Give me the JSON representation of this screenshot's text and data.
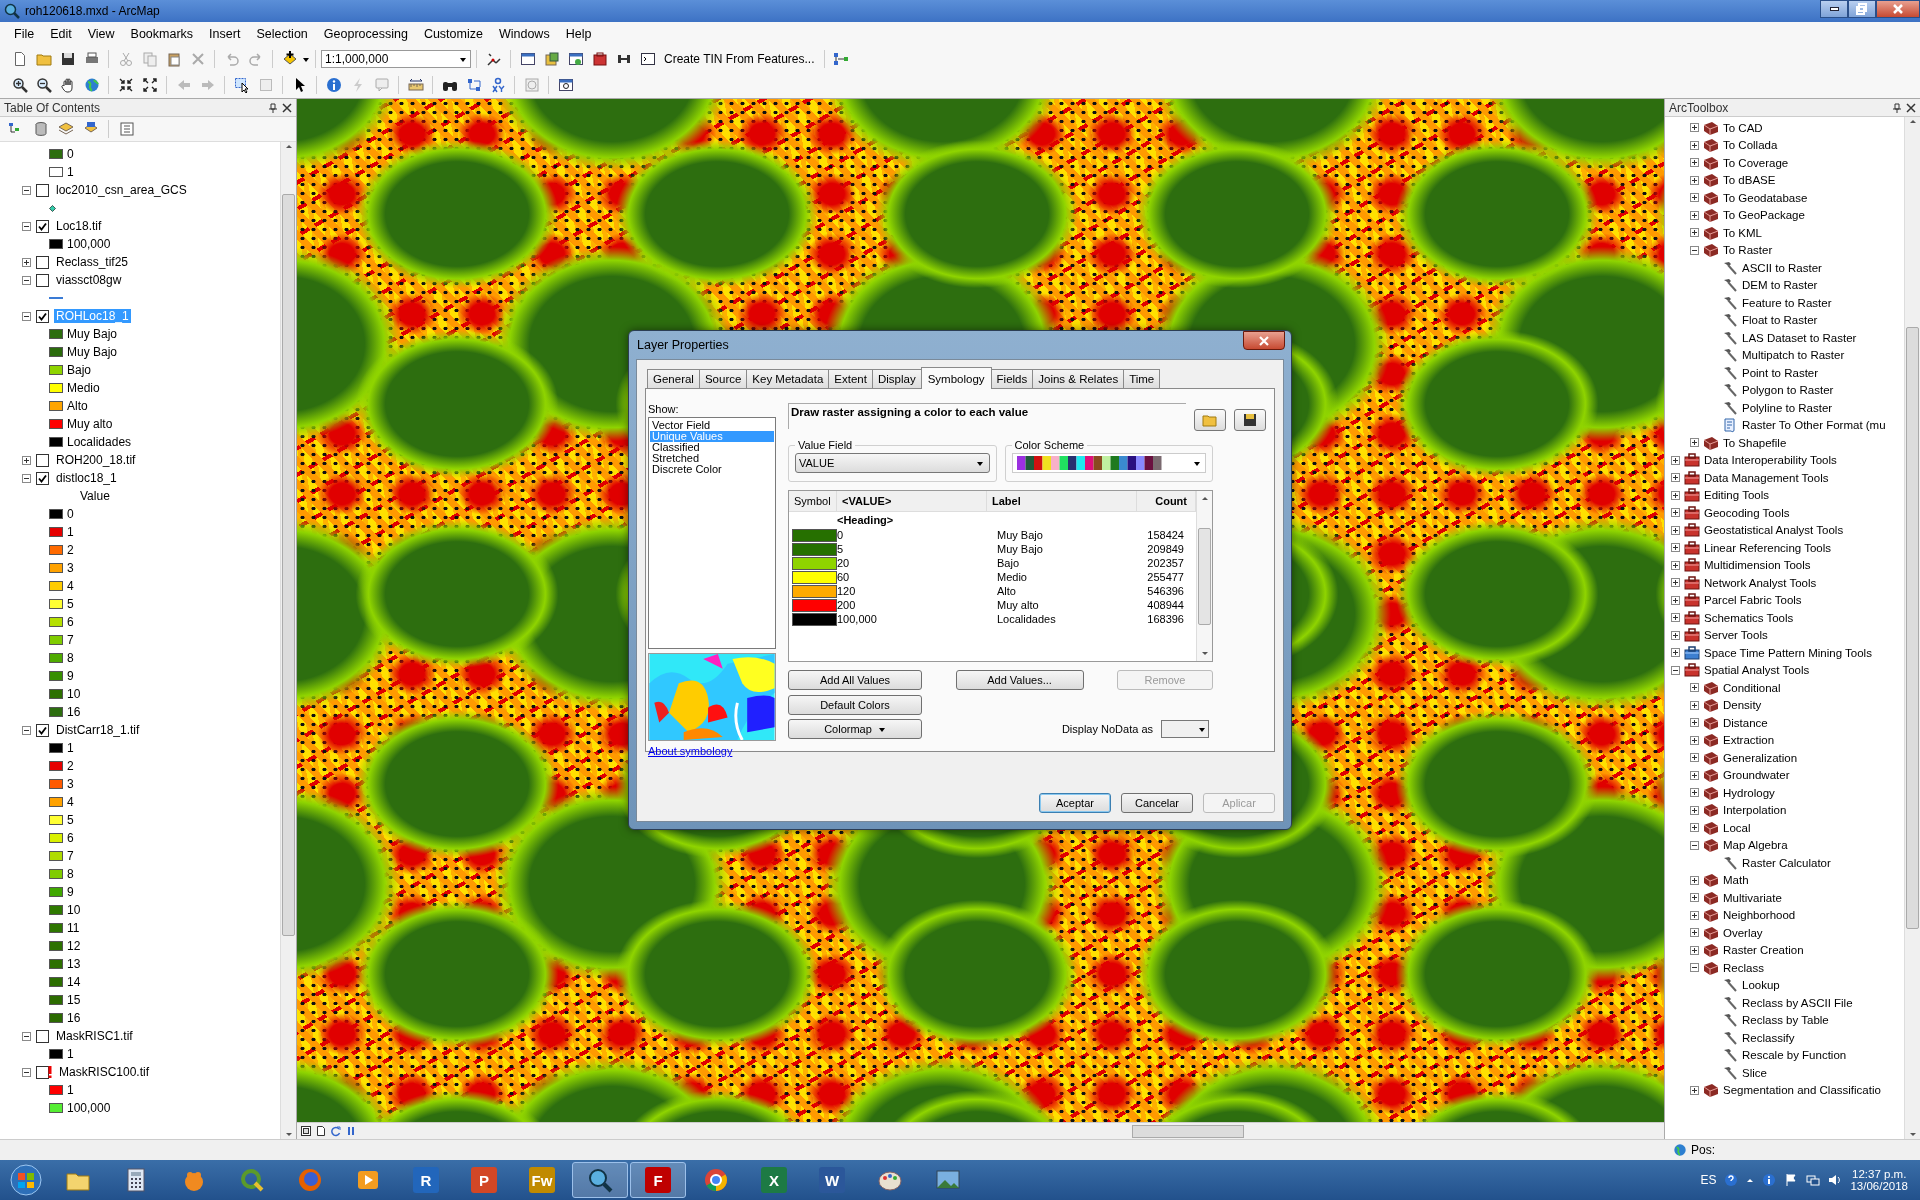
{
  "window": {
    "title": "roh120618.mxd - ArcMap"
  },
  "menu": [
    "File",
    "Edit",
    "View",
    "Bookmarks",
    "Insert",
    "Selection",
    "Geoprocessing",
    "Customize",
    "Windows",
    "Help"
  ],
  "toolbar": {
    "scale": "1:1,000,000",
    "tool_button": "Create TIN From Features..."
  },
  "toc": {
    "title": "Table Of Contents",
    "partial_legend": [
      {
        "kind": "swatch",
        "label": "0",
        "color": "#2d6e0f"
      },
      {
        "kind": "swatch",
        "label": "1",
        "color": "#ffffff"
      }
    ],
    "layers": [
      {
        "name": "loc2010_csn_area_GCS",
        "checked": false,
        "expanded": true,
        "selected": false,
        "warning": false,
        "legend": [
          {
            "kind": "point",
            "color": "#33ccaa"
          }
        ]
      },
      {
        "name": "Loc18.tif",
        "checked": true,
        "expanded": true,
        "selected": false,
        "warning": false,
        "legend": [
          {
            "kind": "swatch",
            "label": "100,000",
            "color": "#000000"
          }
        ]
      },
      {
        "name": "Reclass_tif25",
        "checked": false,
        "expanded": false,
        "selected": false,
        "warning": false
      },
      {
        "name": "viassct08gw",
        "checked": false,
        "expanded": true,
        "selected": false,
        "warning": false,
        "legend": [
          {
            "kind": "line",
            "color": "#3a7bd5"
          }
        ]
      },
      {
        "name": "ROHLoc18_1",
        "checked": true,
        "expanded": true,
        "selected": true,
        "warning": false,
        "legend": [
          {
            "kind": "swatch",
            "label": "Muy Bajo",
            "color": "#2d6e0f"
          },
          {
            "kind": "swatch",
            "label": "Muy Bajo",
            "color": "#2b6b0c"
          },
          {
            "kind": "swatch",
            "label": "Bajo",
            "color": "#8fd400"
          },
          {
            "kind": "swatch",
            "label": "Medio",
            "color": "#ffff00"
          },
          {
            "kind": "swatch",
            "label": "Alto",
            "color": "#ffa500"
          },
          {
            "kind": "swatch",
            "label": "Muy alto",
            "color": "#ff0000"
          },
          {
            "kind": "swatch",
            "label": "Localidades",
            "color": "#000000"
          }
        ]
      },
      {
        "name": "ROH200_18.tif",
        "checked": false,
        "expanded": false,
        "selected": false,
        "warning": false
      },
      {
        "name": "distloc18_1",
        "checked": true,
        "expanded": true,
        "selected": false,
        "warning": false,
        "legend": [
          {
            "kind": "heading",
            "label": "Value"
          },
          {
            "kind": "swatch",
            "label": "0",
            "color": "#000000"
          },
          {
            "kind": "swatch",
            "label": "1",
            "color": "#e60000"
          },
          {
            "kind": "swatch",
            "label": "2",
            "color": "#ff6a00"
          },
          {
            "kind": "swatch",
            "label": "3",
            "color": "#ffa200"
          },
          {
            "kind": "swatch",
            "label": "4",
            "color": "#ffcc00"
          },
          {
            "kind": "swatch",
            "label": "5",
            "color": "#ffff33"
          },
          {
            "kind": "swatch",
            "label": "6",
            "color": "#b5e000"
          },
          {
            "kind": "swatch",
            "label": "7",
            "color": "#80cc00"
          },
          {
            "kind": "swatch",
            "label": "8",
            "color": "#4fab00"
          },
          {
            "kind": "swatch",
            "label": "9",
            "color": "#378f00"
          },
          {
            "kind": "swatch",
            "label": "10",
            "color": "#2d7000"
          },
          {
            "kind": "swatch",
            "label": "16",
            "color": "#2d6e0f"
          }
        ]
      },
      {
        "name": "DistCarr18_1.tif",
        "checked": true,
        "expanded": true,
        "selected": false,
        "warning": false,
        "legend": [
          {
            "kind": "swatch",
            "label": "1",
            "color": "#000000"
          },
          {
            "kind": "swatch",
            "label": "2",
            "color": "#e60000"
          },
          {
            "kind": "swatch",
            "label": "3",
            "color": "#ff5a00"
          },
          {
            "kind": "swatch",
            "label": "4",
            "color": "#ffa200"
          },
          {
            "kind": "swatch",
            "label": "5",
            "color": "#ffff33"
          },
          {
            "kind": "swatch",
            "label": "6",
            "color": "#d9f000"
          },
          {
            "kind": "swatch",
            "label": "7",
            "color": "#b0dc00"
          },
          {
            "kind": "swatch",
            "label": "8",
            "color": "#80cc00"
          },
          {
            "kind": "swatch",
            "label": "9",
            "color": "#40a800"
          },
          {
            "kind": "swatch",
            "label": "10",
            "color": "#2f7a00"
          },
          {
            "kind": "swatch",
            "label": "11",
            "color": "#2e7600"
          },
          {
            "kind": "swatch",
            "label": "12",
            "color": "#2d7200"
          },
          {
            "kind": "swatch",
            "label": "13",
            "color": "#2d7000"
          },
          {
            "kind": "swatch",
            "label": "14",
            "color": "#2c6e00"
          },
          {
            "kind": "swatch",
            "label": "15",
            "color": "#2c6c00"
          },
          {
            "kind": "swatch",
            "label": "16",
            "color": "#2b6a00"
          }
        ]
      },
      {
        "name": "MaskRISC1.tif",
        "checked": false,
        "expanded": true,
        "selected": false,
        "warning": false,
        "legend": [
          {
            "kind": "swatch",
            "label": "1",
            "color": "#000000"
          }
        ]
      },
      {
        "name": "MaskRISC100.tif",
        "checked": false,
        "expanded": true,
        "selected": false,
        "warning": true,
        "legend": [
          {
            "kind": "swatch",
            "label": "1",
            "color": "#ff0000"
          },
          {
            "kind": "swatch",
            "label": "100,000",
            "color": "#55ee33"
          }
        ]
      }
    ]
  },
  "dialog": {
    "title": "Layer Properties",
    "tabs": [
      {
        "label": "General",
        "selected": false
      },
      {
        "label": "Source",
        "selected": false
      },
      {
        "label": "Key Metadata",
        "selected": false
      },
      {
        "label": "Extent",
        "selected": false
      },
      {
        "label": "Display",
        "selected": false
      },
      {
        "label": "Symbology",
        "selected": true
      },
      {
        "label": "Fields",
        "selected": false
      },
      {
        "label": "Joins & Relates",
        "selected": false
      },
      {
        "label": "Time",
        "selected": false
      }
    ],
    "show_label": "Show:",
    "show_items": [
      {
        "label": "Vector Field",
        "selected": false
      },
      {
        "label": "Unique Values",
        "selected": true
      },
      {
        "label": "Classified",
        "selected": false
      },
      {
        "label": "Stretched",
        "selected": false
      },
      {
        "label": "Discrete Color",
        "selected": false
      }
    ],
    "about_link": "About symbology",
    "description": "Draw raster assigning a color to each value",
    "value_field": {
      "label": "Value Field",
      "value": "VALUE"
    },
    "color_scheme": {
      "label": "Color Scheme"
    },
    "table": {
      "columns": [
        "Symbol",
        "<VALUE>",
        "Label",
        "Count"
      ],
      "heading": "<Heading>",
      "rows": [
        {
          "color": "#267000",
          "value": "0",
          "label": "Muy Bajo",
          "count": "158424"
        },
        {
          "color": "#267000",
          "value": "5",
          "label": "Muy Bajo",
          "count": "209849"
        },
        {
          "color": "#8fd400",
          "value": "20",
          "label": "Bajo",
          "count": "202357"
        },
        {
          "color": "#ffff00",
          "value": "60",
          "label": "Medio",
          "count": "255477"
        },
        {
          "color": "#ffaa00",
          "value": "120",
          "label": "Alto",
          "count": "546396"
        },
        {
          "color": "#ff0000",
          "value": "200",
          "label": "Muy alto",
          "count": "408944"
        },
        {
          "color": "#000000",
          "value": "100,000",
          "label": "Localidades",
          "count": "168396"
        }
      ]
    },
    "actions": [
      {
        "label": "Add All Values",
        "disabled": false
      },
      {
        "label": "Add Values...",
        "disabled": false
      },
      {
        "label": "Remove",
        "disabled": true
      }
    ],
    "default_colors": "Default Colors",
    "colormap": "Colormap",
    "nodata_label": "Display NoData as",
    "buttons": [
      {
        "label": "Aceptar",
        "disabled": false,
        "default": true
      },
      {
        "label": "Cancelar",
        "disabled": false,
        "default": false
      },
      {
        "label": "Aplicar",
        "disabled": true,
        "default": false
      }
    ]
  },
  "arctoolbox": {
    "title": "ArcToolbox",
    "continued_items": [
      {
        "kind": "toolset",
        "label": "To CAD",
        "expanded": false
      },
      {
        "kind": "toolset",
        "label": "To Collada",
        "expanded": false
      },
      {
        "kind": "toolset",
        "label": "To Coverage",
        "expanded": false
      },
      {
        "kind": "toolset",
        "label": "To dBASE",
        "expanded": false
      },
      {
        "kind": "toolset",
        "label": "To Geodatabase",
        "expanded": false
      },
      {
        "kind": "toolset",
        "label": "To GeoPackage",
        "expanded": false
      },
      {
        "kind": "toolset",
        "label": "To KML",
        "expanded": false
      },
      {
        "kind": "toolset",
        "label": "To Raster",
        "expanded": true,
        "children": [
          {
            "kind": "tool",
            "label": "ASCII to Raster"
          },
          {
            "kind": "tool",
            "label": "DEM to Raster"
          },
          {
            "kind": "tool",
            "label": "Feature to Raster"
          },
          {
            "kind": "tool",
            "label": "Float to Raster"
          },
          {
            "kind": "tool",
            "label": "LAS Dataset to Raster"
          },
          {
            "kind": "tool",
            "label": "Multipatch to Raster"
          },
          {
            "kind": "tool",
            "label": "Point to Raster"
          },
          {
            "kind": "tool",
            "label": "Polygon to Raster"
          },
          {
            "kind": "tool",
            "label": "Polyline to Raster"
          },
          {
            "kind": "script",
            "label": "Raster To Other Format (mu"
          }
        ]
      },
      {
        "kind": "toolset",
        "label": "To Shapefile",
        "expanded": false
      }
    ],
    "items": [
      {
        "kind": "toolbox",
        "label": "Data Interoperability Tools",
        "expanded": false
      },
      {
        "kind": "toolbox",
        "label": "Data Management Tools",
        "expanded": false
      },
      {
        "kind": "toolbox",
        "label": "Editing Tools",
        "expanded": false
      },
      {
        "kind": "toolbox",
        "label": "Geocoding Tools",
        "expanded": false
      },
      {
        "kind": "toolbox",
        "label": "Geostatistical Analyst Tools",
        "expanded": false
      },
      {
        "kind": "toolbox",
        "label": "Linear Referencing Tools",
        "expanded": false
      },
      {
        "kind": "toolbox",
        "label": "Multidimension Tools",
        "expanded": false
      },
      {
        "kind": "toolbox",
        "label": "Network Analyst Tools",
        "expanded": false
      },
      {
        "kind": "toolbox",
        "label": "Parcel Fabric Tools",
        "expanded": false
      },
      {
        "kind": "toolbox",
        "label": "Schematics Tools",
        "expanded": false
      },
      {
        "kind": "toolbox",
        "label": "Server Tools",
        "expanded": false
      },
      {
        "kind": "toolbox_blue",
        "label": "Space Time Pattern Mining Tools",
        "expanded": false
      },
      {
        "kind": "toolbox",
        "label": "Spatial Analyst Tools",
        "expanded": true,
        "children": [
          {
            "kind": "toolset",
            "label": "Conditional",
            "expanded": false
          },
          {
            "kind": "toolset",
            "label": "Density",
            "expanded": false
          },
          {
            "kind": "toolset",
            "label": "Distance",
            "expanded": false
          },
          {
            "kind": "toolset",
            "label": "Extraction",
            "expanded": false
          },
          {
            "kind": "toolset",
            "label": "Generalization",
            "expanded": false
          },
          {
            "kind": "toolset",
            "label": "Groundwater",
            "expanded": false
          },
          {
            "kind": "toolset",
            "label": "Hydrology",
            "expanded": false
          },
          {
            "kind": "toolset",
            "label": "Interpolation",
            "expanded": false
          },
          {
            "kind": "toolset",
            "label": "Local",
            "expanded": false
          },
          {
            "kind": "toolset",
            "label": "Map Algebra",
            "expanded": true,
            "children": [
              {
                "kind": "tool",
                "label": "Raster Calculator"
              }
            ]
          },
          {
            "kind": "toolset",
            "label": "Math",
            "expanded": false
          },
          {
            "kind": "toolset",
            "label": "Multivariate",
            "expanded": false
          },
          {
            "kind": "toolset",
            "label": "Neighborhood",
            "expanded": false
          },
          {
            "kind": "toolset",
            "label": "Overlay",
            "expanded": false
          },
          {
            "kind": "toolset",
            "label": "Raster Creation",
            "expanded": false
          },
          {
            "kind": "toolset",
            "label": "Reclass",
            "expanded": true,
            "children": [
              {
                "kind": "tool",
                "label": "Lookup"
              },
              {
                "kind": "tool",
                "label": "Reclass by ASCII File"
              },
              {
                "kind": "tool",
                "label": "Reclass by Table"
              },
              {
                "kind": "tool",
                "label": "Reclassify"
              },
              {
                "kind": "tool",
                "label": "Rescale by Function"
              },
              {
                "kind": "tool",
                "label": "Slice"
              }
            ]
          },
          {
            "kind": "toolset",
            "label": "Segmentation and Classificatio",
            "expanded": false
          }
        ]
      }
    ]
  },
  "status_bar": {
    "position_label": "Pos:"
  },
  "taskbar": {
    "apps": [
      {
        "kind": "folder",
        "selected": false
      },
      {
        "kind": "calculator",
        "selected": false
      },
      {
        "kind": "paw",
        "selected": false
      },
      {
        "kind": "qgis",
        "selected": false
      },
      {
        "kind": "firefox",
        "selected": false
      },
      {
        "kind": "media",
        "selected": false
      },
      {
        "kind": "letter",
        "glyph": "R",
        "color": "#2266bb",
        "selected": false
      },
      {
        "kind": "letter",
        "glyph": "P",
        "color": "#d24726",
        "selected": false
      },
      {
        "kind": "letter",
        "glyph": "Fw",
        "color": "#c08a00",
        "selected": false
      },
      {
        "kind": "arcmap",
        "selected": true
      },
      {
        "kind": "letter",
        "glyph": "F",
        "color": "#bf0000",
        "selected": true
      },
      {
        "kind": "chrome",
        "selected": false
      },
      {
        "kind": "letter",
        "glyph": "X",
        "color": "#1d7a44",
        "selected": false
      },
      {
        "kind": "letter",
        "glyph": "W",
        "color": "#2b579a",
        "selected": false
      },
      {
        "kind": "paint",
        "selected": false
      },
      {
        "kind": "screen",
        "selected": false
      }
    ],
    "language": "ES",
    "time": "12:37 p.m.",
    "date": "13/06/2018"
  }
}
